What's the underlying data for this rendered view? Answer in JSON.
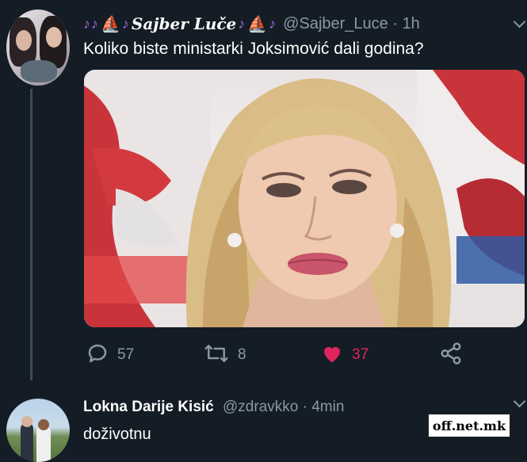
{
  "tweet": {
    "display_name": "Sajber Luče",
    "decor_note": "♪",
    "decor_boat": "⛵",
    "handle": "@Sajber_Luce",
    "time": "1h",
    "text": "Koliko biste ministarki Joksimović dali godina?",
    "media_icon": "photo-portrait",
    "reply_count": "57",
    "retweet_count": "8",
    "like_count": "37",
    "colors": {
      "like": "#e0245e",
      "muted": "#8899a6",
      "background": "#141d26",
      "name_decor": "#9c6bd8"
    }
  },
  "reply": {
    "display_name": "Lokna Darije Kisić",
    "handle": "@zdravkko",
    "time": "4min",
    "text": "doživotnu"
  },
  "watermark": {
    "text": "off.net.mk"
  },
  "icons": {
    "reply": "speech-bubble-icon",
    "retweet": "retweet-arrows-icon",
    "like": "heart-icon",
    "share": "share-nodes-icon",
    "menu": "chevron-down-icon"
  }
}
